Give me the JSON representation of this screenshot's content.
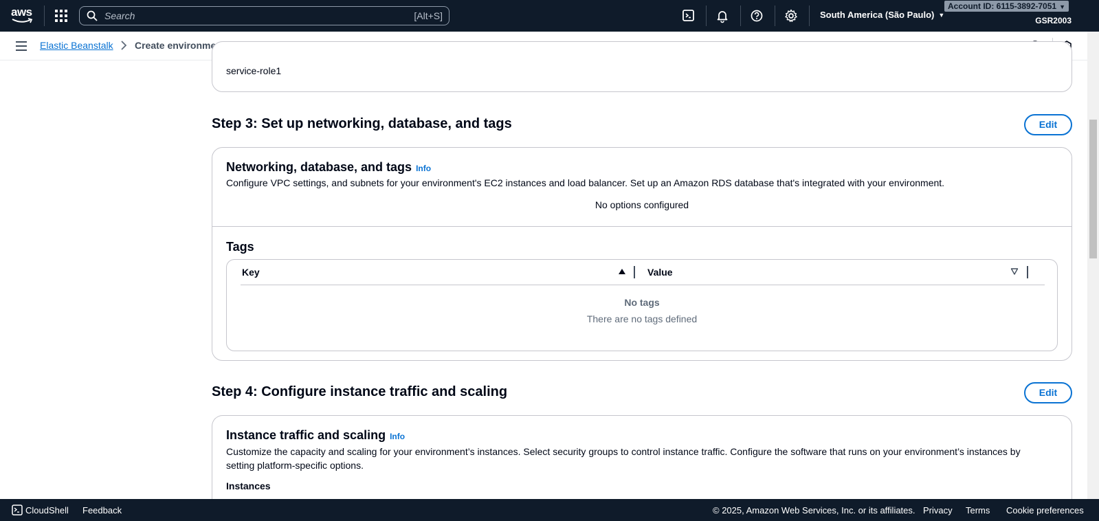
{
  "topnav": {
    "logo_text": "aws",
    "search_placeholder": "Search",
    "search_shortcut": "[Alt+S]",
    "icons": [
      "cloudshell-icon",
      "bell-icon",
      "help-icon",
      "gear-icon"
    ],
    "region": "South America (São Paulo)",
    "account": "Account ID: 6115-3892-7051",
    "user": "GSR2003"
  },
  "breadcrumb": {
    "items": [
      "Elastic Beanstalk",
      "Create environment"
    ]
  },
  "previous_section": {
    "role_text": "service-role1"
  },
  "step3": {
    "title": "Step 3: Set up networking, database, and tags",
    "edit_label": "Edit",
    "section_title": "Networking, database, and tags",
    "info_label": "Info",
    "description": "Configure VPC settings, and subnets for your environment's EC2 instances and load balancer. Set up an Amazon RDS database that's integrated with your environment.",
    "no_options": "No options configured",
    "tags": {
      "title": "Tags",
      "columns": [
        "Key",
        "Value"
      ],
      "empty_title": "No tags",
      "empty_desc": "There are no tags defined"
    }
  },
  "step4": {
    "title": "Step 4: Configure instance traffic and scaling",
    "edit_label": "Edit",
    "section_title": "Instance traffic and scaling",
    "info_label": "Info",
    "description": "Customize the capacity and scaling for your environment’s instances. Select security groups to control instance traffic. Configure the software that runs on your environment’s instances by setting platform-specific options.",
    "subheading": "Instances"
  },
  "footer": {
    "cloudshell": "CloudShell",
    "feedback": "Feedback",
    "copyright": "© 2025, Amazon Web Services, Inc. or its affiliates.",
    "privacy": "Privacy",
    "terms": "Terms",
    "cookies": "Cookie preferences"
  },
  "colors": {
    "nav_bg": "#0f1b2a",
    "link": "#0972d3",
    "border": "#c6c6cd"
  }
}
